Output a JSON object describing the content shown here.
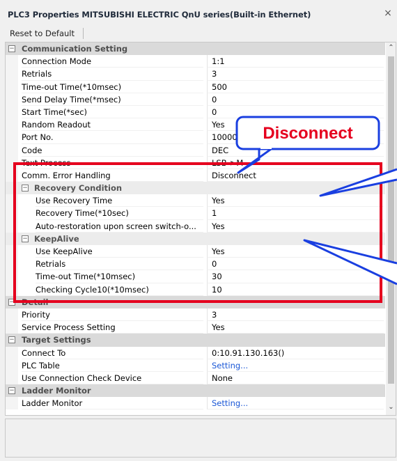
{
  "window": {
    "title": "PLC3 Properties MITSUBISHI ELECTRIC QnU series(Built-in Ethernet)",
    "close_glyph": "×"
  },
  "toolbar": {
    "reset_label": "Reset to Default"
  },
  "categories": {
    "communication": "Communication Setting",
    "recovery": "Recovery Condition",
    "keepalive": "KeepAlive",
    "detail": "Detail",
    "target": "Target Settings",
    "ladder": "Ladder Monitor"
  },
  "communication": [
    {
      "name": "Connection Mode",
      "value": "1:1"
    },
    {
      "name": "Retrials",
      "value": "3"
    },
    {
      "name": "Time-out Time(*10msec)",
      "value": "500"
    },
    {
      "name": "Send Delay Time(*msec)",
      "value": "0"
    },
    {
      "name": "Start Time(*sec)",
      "value": "0"
    },
    {
      "name": "Random Readout",
      "value": "Yes"
    },
    {
      "name": "Port No.",
      "value": "10000"
    },
    {
      "name": "Code",
      "value": "DEC"
    },
    {
      "name": "Text Process",
      "value": "LSB->M"
    },
    {
      "name": "Comm. Error Handling",
      "value": "Disconnect"
    }
  ],
  "recovery": [
    {
      "name": "Use Recovery Time",
      "value": "Yes"
    },
    {
      "name": "Recovery Time(*10sec)",
      "value": "1"
    },
    {
      "name": "Auto-restoration upon screen switch-o...",
      "value": "Yes"
    }
  ],
  "keepalive": [
    {
      "name": "Use KeepAlive",
      "value": "Yes"
    },
    {
      "name": "Retrials",
      "value": "0"
    },
    {
      "name": "Time-out Time(*10msec)",
      "value": "30"
    },
    {
      "name": "Checking Cycle10(*10msec)",
      "value": "10"
    }
  ],
  "detail": [
    {
      "name": "Priority",
      "value": "3"
    },
    {
      "name": "Service Process Setting",
      "value": "Yes"
    }
  ],
  "target": [
    {
      "name": "Connect To",
      "value": "0:10.91.130.163()"
    },
    {
      "name": "PLC Table",
      "value": "Setting..."
    },
    {
      "name": "Use Connection Check Device",
      "value": "None"
    }
  ],
  "ladder": [
    {
      "name": "Ladder Monitor",
      "value": "Setting..."
    }
  ],
  "callout": {
    "text": "Disconnect"
  },
  "colors": {
    "highlight": "#e5001e",
    "callout_border": "#1a3fe0",
    "link": "#1a57d6"
  },
  "icons": {
    "collapse": "minus-box-icon",
    "scroll_up": "chevron-up-icon",
    "scroll_down": "chevron-down-icon"
  }
}
